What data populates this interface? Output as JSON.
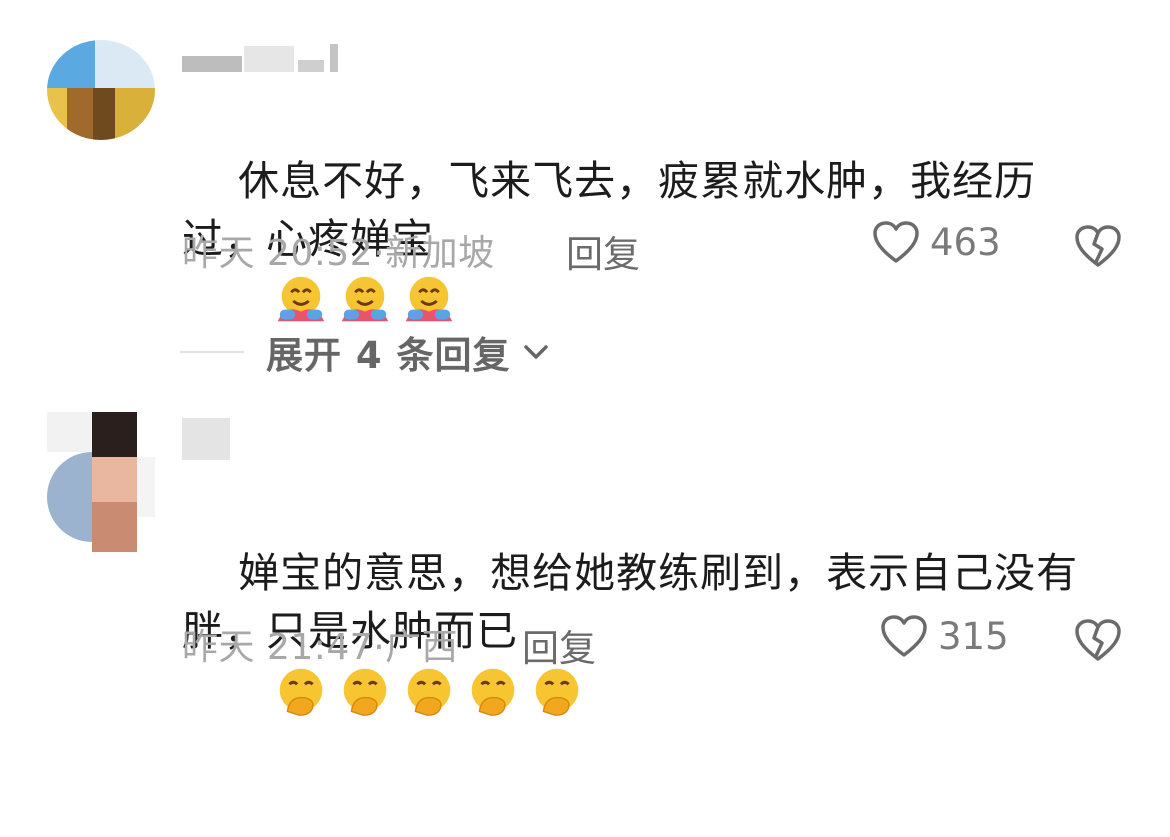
{
  "comments": [
    {
      "text": "休息不好，飞来飞去，疲累就水肿，我经历过，心疼婵宝",
      "emoji": "hugging-face-icon",
      "emoji_count": 3,
      "time": "昨天 20:52",
      "location": "新加坡",
      "reply_label": "回复",
      "likes": "463"
    },
    {
      "text": "婵宝的意思，想给她教练刷到，表示自己没有胖，只是水肿而已",
      "emoji": "hand-over-mouth-face-icon",
      "emoji_count": 5,
      "time": "昨天 21:47",
      "location": "广西",
      "reply_label": "回复",
      "likes": "315"
    }
  ],
  "expand_replies": {
    "label": "展开 4 条回复"
  },
  "colors": {
    "text": "#1c1c1c",
    "meta": "#a8a8a8",
    "icon": "#6b6b6b"
  }
}
